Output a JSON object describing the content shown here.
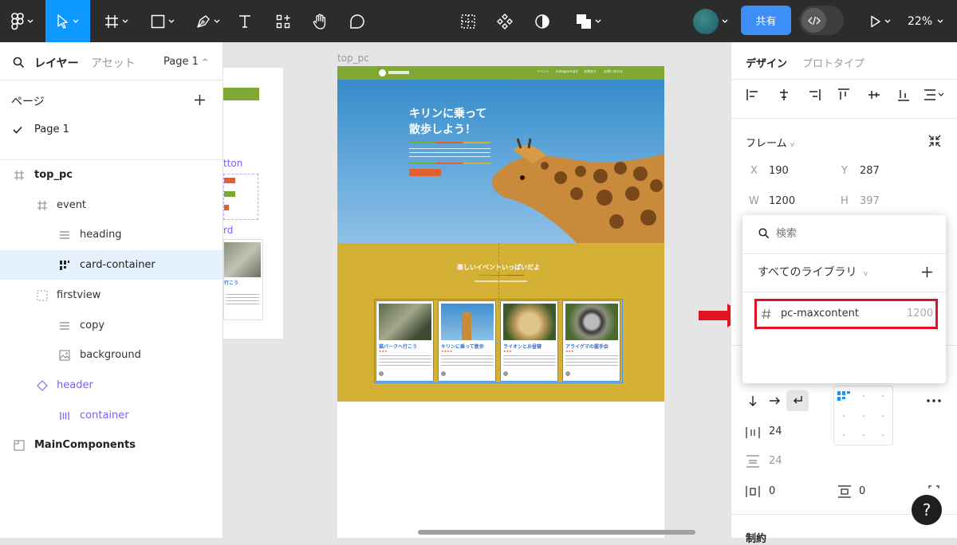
{
  "toolbar": {
    "share_label": "共有",
    "zoom_label": "22%"
  },
  "left_panel": {
    "tabs": {
      "layers": "レイヤー",
      "assets": "アセット",
      "page_selector": "Page 1"
    },
    "pages_heading": "ページ",
    "pages": [
      {
        "label": "Page 1",
        "selected": true
      }
    ],
    "layers": [
      {
        "label": "top_pc",
        "icon": "frame-icon"
      },
      {
        "label": "event",
        "icon": "frame-icon"
      },
      {
        "label": "heading",
        "icon": "text-lines-icon"
      },
      {
        "label": "card-container",
        "icon": "grid-layout-icon"
      },
      {
        "label": "firstview",
        "icon": "dashed-frame-icon"
      },
      {
        "label": "copy",
        "icon": "text-lines-icon"
      },
      {
        "label": "background",
        "icon": "image-icon"
      },
      {
        "label": "header",
        "icon": "component-icon"
      },
      {
        "label": "container",
        "icon": "instance-layout-icon"
      },
      {
        "label": "MainComponents",
        "icon": "section-icon"
      }
    ]
  },
  "canvas": {
    "frame_label": "top_pc",
    "left_fragments": {
      "button_label": "tton",
      "card_label": "rd",
      "card_title": "行こう"
    },
    "firstview": {
      "headline_line1": "キリンに乗って",
      "headline_line2": "散歩しよう！",
      "nav_items": [
        "イベント",
        "Instagramほか",
        "お問合せ",
        "お問い合わせ"
      ]
    },
    "event": {
      "heading": "楽しいイベントいっぱいだよ"
    },
    "cards": [
      {
        "title": "猫パークへ行こう",
        "stars": "★★★"
      },
      {
        "title": "キリンに乗って散歩",
        "stars": "★★★★"
      },
      {
        "title": "ライオンとお昼寝",
        "stars": "★★★"
      },
      {
        "title": "アライグマの握手会",
        "stars": "★★★"
      }
    ]
  },
  "right_panel": {
    "tabs": {
      "design": "デザイン",
      "prototype": "プロトタイプ"
    },
    "frame_section": "フレーム",
    "x_label": "X",
    "x_value": "190",
    "y_label": "Y",
    "y_value": "287",
    "w_label": "W",
    "w_value": "1200",
    "h_label": "H",
    "h_value": "397",
    "gap_value": "24",
    "gap2_value": "24",
    "padding_h_value": "0",
    "padding_v_value": "0",
    "constraints_label": "制約"
  },
  "popup": {
    "search_placeholder": "検索",
    "library_selector": "すべてのライブラリ",
    "item_name": "pc-maxcontent",
    "item_value": "1200"
  },
  "colors": {
    "accent": "#0d99ff",
    "share": "#3d8ff7",
    "highlight_box": "#e0141e",
    "arrow": "#e0141e",
    "toolbar_bg": "#2c2c2c"
  }
}
